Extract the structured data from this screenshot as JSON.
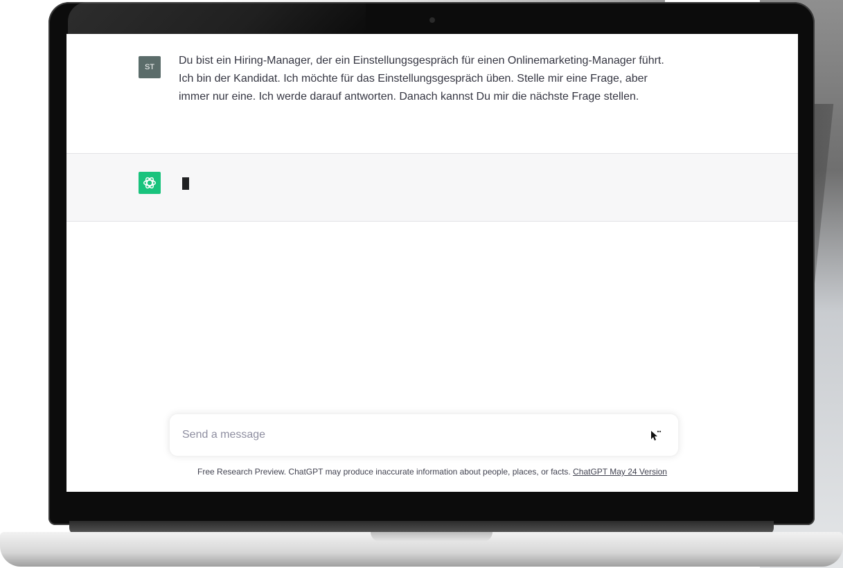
{
  "chat": {
    "user_message": {
      "avatar_initials": "ST",
      "text": "Du bist ein Hiring-Manager, der ein Einstellungsgespräch für einen Onlinemarketing-Manager führt. Ich bin der Kandidat. Ich möchte für das Einstellungsgespräch üben. Stelle mir eine Frage, aber immer nur eine. Ich werde darauf antworten. Danach kannst Du mir die nächste Frage stellen."
    },
    "assistant_message": {
      "avatar_icon": "openai-logo-icon",
      "status": "typing"
    }
  },
  "composer": {
    "placeholder": "Send a message",
    "send_icon": "loading-dots-icon"
  },
  "footer": {
    "text": "Free Research Preview. ChatGPT may produce inaccurate information about people, places, or facts.",
    "link": "ChatGPT May 24 Version"
  },
  "colors": {
    "user_avatar": "#5b6c6a",
    "assistant_avatar": "#19c37d",
    "assistant_row_bg": "#f7f7f8",
    "text": "#343541"
  }
}
